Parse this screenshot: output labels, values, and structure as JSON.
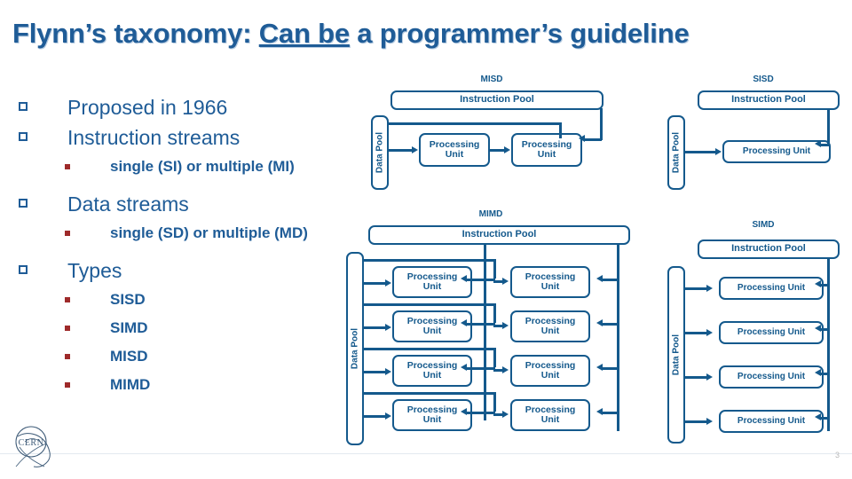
{
  "slide": {
    "title_prefix": "Flynn’s taxonomy: ",
    "title_underlined": "Can be",
    "title_suffix": " a programmer’s guideline",
    "page_number": "3",
    "logo_text": "CERN",
    "accent_color": "#1F5C97",
    "diagram_color": "#14598C",
    "sub_bullet_color": "#9E2A2A"
  },
  "bullets": [
    {
      "level": 1,
      "text": "Proposed in 1966"
    },
    {
      "level": 1,
      "text": "Instruction streams"
    },
    {
      "level": 2,
      "text": "single (SI) or multiple (MI)"
    },
    {
      "level": 1,
      "text": "Data streams"
    },
    {
      "level": 2,
      "text": "single (SD) or multiple (MD)"
    },
    {
      "level": 1,
      "text": "Types"
    },
    {
      "level": 2,
      "text": "SISD"
    },
    {
      "level": 2,
      "text": "SIMD"
    },
    {
      "level": 2,
      "text": "MISD"
    },
    {
      "level": 2,
      "text": "MIMD"
    }
  ],
  "diagrams": {
    "misd": {
      "label": "MISD",
      "instruction_pool": "Instruction Pool",
      "data_pool": "Data Pool",
      "unit_label_line1": "Processing",
      "unit_label_line2": "Unit",
      "unit_count": 2
    },
    "sisd": {
      "label": "SISD",
      "instruction_pool": "Instruction Pool",
      "data_pool": "Data Pool",
      "unit_label": "Processing Unit",
      "unit_count": 1
    },
    "mimd": {
      "label": "MIMD",
      "instruction_pool": "Instruction Pool",
      "data_pool": "Data Pool",
      "unit_label_line1": "Processing",
      "unit_label_line2": "Unit",
      "rows": 4,
      "columns": 2,
      "unit_count": 8
    },
    "simd": {
      "label": "SIMD",
      "instruction_pool": "Instruction Pool",
      "data_pool": "Data Pool",
      "unit_label": "Processing Unit",
      "unit_count": 4
    }
  }
}
